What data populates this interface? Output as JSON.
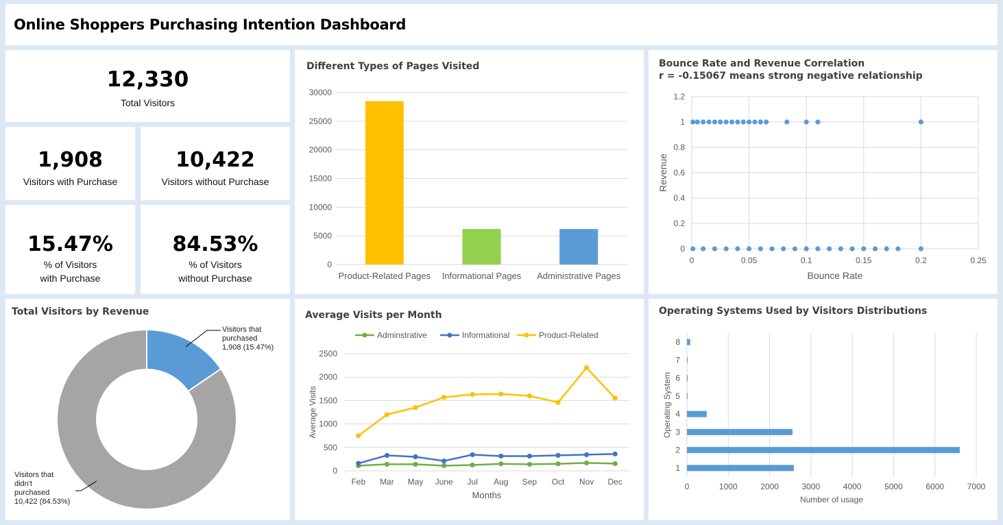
{
  "header": {
    "title": "Online Shoppers Purchasing Intention Dashboard"
  },
  "kpis": {
    "total": {
      "value": "12,330",
      "label": "Total Visitors"
    },
    "with_purchase": {
      "value": "1,908",
      "label": "Visitors with Purchase"
    },
    "without_purchase": {
      "value": "10,422",
      "label": "Visitors without Purchase"
    },
    "pct_with": {
      "value": "15.47%",
      "label1": "% of Visitors",
      "label2": "with Purchase"
    },
    "pct_without": {
      "value": "84.53%",
      "label1": "% of Visitors",
      "label2": "without Purchase"
    }
  },
  "colors": {
    "yellow": "#ffc000",
    "green": "#92d050",
    "blue": "#5b9bd5",
    "gray": "#a5a5a5",
    "line_blue": "#4472c4",
    "line_green": "#70ad47"
  },
  "chart_data": [
    {
      "type": "bar",
      "title": "Different Types of Pages Visited",
      "categories": [
        "Product-Related Pages",
        "Informational Pages",
        "Administrative Pages"
      ],
      "values": [
        28500,
        6200,
        6200
      ],
      "colors": [
        "#ffc000",
        "#92d050",
        "#5b9bd5"
      ],
      "ylim": [
        0,
        30000
      ],
      "yticks": [
        "0",
        "5000",
        "10000",
        "15000",
        "20000",
        "25000",
        "30000"
      ],
      "grid": true
    },
    {
      "type": "scatter",
      "title": "Bounce Rate and Revenue Correlation",
      "subtitle": "r = -0.15067 means strong negative relationship",
      "xlabel": "Bounce Rate",
      "ylabel": "Revenue",
      "xlim": [
        0,
        0.25
      ],
      "ylim": [
        0,
        1.2
      ],
      "xticks": [
        "0",
        "0.05",
        "0.1",
        "0.15",
        "0.2",
        "0.25"
      ],
      "yticks": [
        "0",
        "0.2",
        "0.4",
        "0.6",
        "0.8",
        "1",
        "1.2"
      ],
      "series": [
        {
          "points": [
            [
              0.001,
              1
            ],
            [
              0.005,
              1
            ],
            [
              0.01,
              1
            ],
            [
              0.015,
              1
            ],
            [
              0.02,
              1
            ],
            [
              0.025,
              1
            ],
            [
              0.03,
              1
            ],
            [
              0.035,
              1
            ],
            [
              0.04,
              1
            ],
            [
              0.045,
              1
            ],
            [
              0.05,
              1
            ],
            [
              0.055,
              1
            ],
            [
              0.06,
              1
            ],
            [
              0.065,
              1
            ],
            [
              0.083,
              1
            ],
            [
              0.1,
              1
            ],
            [
              0.11,
              1
            ],
            [
              0.2,
              1
            ]
          ]
        },
        {
          "points": [
            [
              0.001,
              0
            ],
            [
              0.01,
              0
            ],
            [
              0.02,
              0
            ],
            [
              0.03,
              0
            ],
            [
              0.04,
              0
            ],
            [
              0.05,
              0
            ],
            [
              0.06,
              0
            ],
            [
              0.07,
              0
            ],
            [
              0.08,
              0
            ],
            [
              0.09,
              0
            ],
            [
              0.1,
              0
            ],
            [
              0.11,
              0
            ],
            [
              0.12,
              0
            ],
            [
              0.13,
              0
            ],
            [
              0.14,
              0
            ],
            [
              0.15,
              0
            ],
            [
              0.16,
              0
            ],
            [
              0.17,
              0
            ],
            [
              0.18,
              0
            ],
            [
              0.2,
              0
            ]
          ]
        }
      ],
      "grid": true
    },
    {
      "type": "pie",
      "title": "Total Visitors by Revenue",
      "donut": true,
      "slices": [
        {
          "value": 1908,
          "color": "#5b9bd5",
          "label_lines": [
            "Visitors that",
            "purchased",
            "1,908 (15.47%)"
          ]
        },
        {
          "value": 10422,
          "color": "#a5a5a5",
          "label_lines": [
            "Visitors that",
            "didn't",
            "purchased",
            "10,422 (84.53%)"
          ]
        }
      ]
    },
    {
      "type": "line",
      "title": "Average Visits per Month",
      "xlabel": "Months",
      "ylabel": "Average Visits",
      "categories": [
        "Feb",
        "Mar",
        "May",
        "June",
        "Jul",
        "Aug",
        "Sep",
        "Oct",
        "Nov",
        "Dec"
      ],
      "ylim": [
        0,
        2500
      ],
      "yticks": [
        "0",
        "500",
        "1000",
        "1500",
        "2000",
        "2500"
      ],
      "legend": "top",
      "series": [
        {
          "name": "Adminstrative",
          "color": "#70ad47",
          "values": [
            110,
            140,
            140,
            110,
            125,
            150,
            140,
            150,
            170,
            155
          ]
        },
        {
          "name": "Informational",
          "color": "#4472c4",
          "values": [
            160,
            330,
            300,
            210,
            345,
            315,
            315,
            330,
            345,
            360
          ]
        },
        {
          "name": "Product-Related",
          "color": "#ffc000",
          "values": [
            750,
            1200,
            1350,
            1570,
            1630,
            1640,
            1600,
            1460,
            2200,
            1550
          ]
        }
      ],
      "grid": true
    },
    {
      "type": "bar",
      "orientation": "horizontal",
      "title": "Operating Systems Used by Visitors Distributions",
      "xlabel": "Number of usage",
      "ylabel": "Operating System",
      "categories": [
        "1",
        "2",
        "3",
        "4",
        "5",
        "6",
        "7",
        "8"
      ],
      "values": [
        2585,
        6601,
        2555,
        478,
        6,
        19,
        7,
        79
      ],
      "color": "#5b9bd5",
      "xlim": [
        0,
        7000
      ],
      "xticks": [
        "0",
        "1000",
        "2000",
        "3000",
        "4000",
        "5000",
        "6000",
        "7000"
      ],
      "grid": true
    }
  ]
}
